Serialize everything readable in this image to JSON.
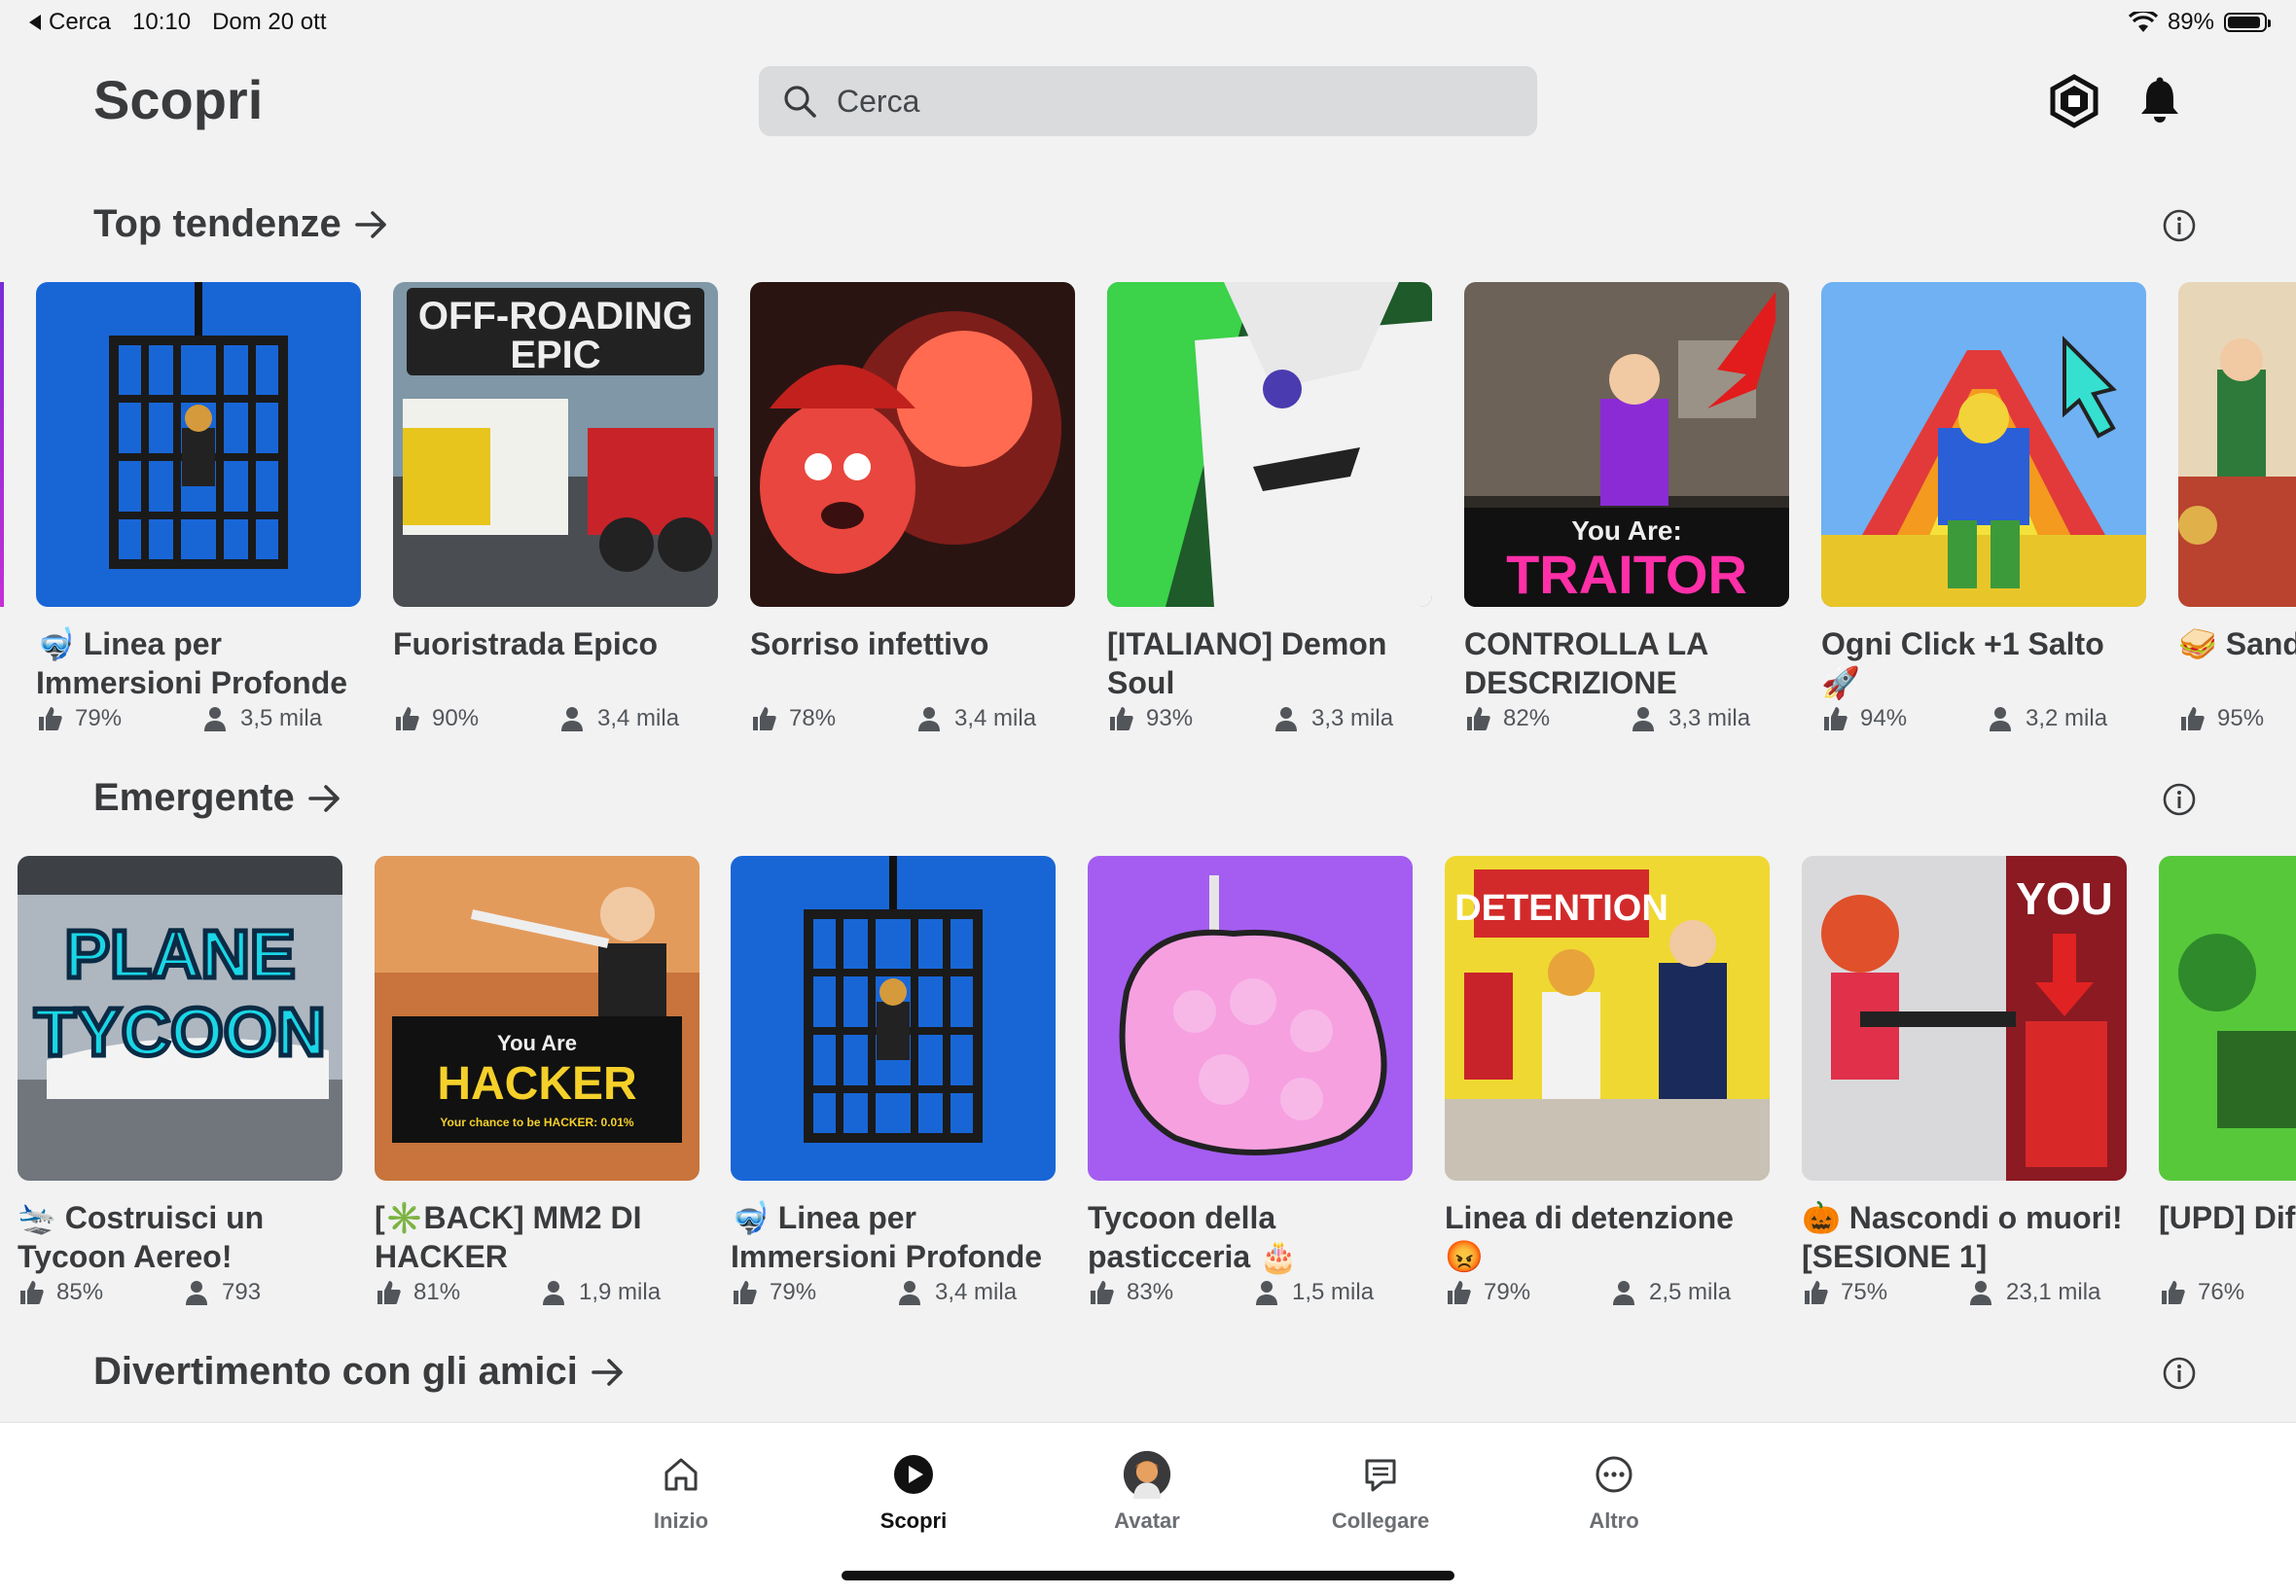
{
  "status_bar": {
    "back_label": "Cerca",
    "time": "10:10",
    "date": "Dom 20 ott",
    "battery": "89%"
  },
  "header": {
    "title": "Scopri",
    "search_placeholder": "Cerca"
  },
  "sections": [
    {
      "title": "Top tendenze",
      "cards": [
        {
          "title": "🤿 Linea per Immersioni Profonde",
          "rating": "79%",
          "players": "3,5 mila"
        },
        {
          "title": "Fuoristrada Epico",
          "rating": "90%",
          "players": "3,4 mila",
          "thumb_text": "OFF-ROADING EPIC"
        },
        {
          "title": "Sorriso infettivo",
          "rating": "78%",
          "players": "3,4 mila"
        },
        {
          "title": "[ITALIANO] Demon Soul",
          "rating": "93%",
          "players": "3,3 mila"
        },
        {
          "title": "CONTROLLA LA DESCRIZIONE",
          "rating": "82%",
          "players": "3,3 mila",
          "thumb_text_small": "You Are:",
          "thumb_text": "TRAITOR"
        },
        {
          "title": "Ogni Click +1 Salto 🚀",
          "rating": "94%",
          "players": "3,2 mila"
        },
        {
          "title": "🥪 Sand Ristoran",
          "rating": "95%",
          "players": ""
        }
      ]
    },
    {
      "title": "Emergente",
      "cards": [
        {
          "title": "🛬 Costruisci un Tycoon Aereo!",
          "rating": "85%",
          "players": "793",
          "thumb_text": "PLANE TYCOON"
        },
        {
          "title": "[✳️BACK] MM2 DI HACKER",
          "rating": "81%",
          "players": "1,9 mila",
          "thumb_text_small": "You Are",
          "thumb_text": "HACKER",
          "thumb_text_tiny": "Your chance to be HACKER: 0.01%"
        },
        {
          "title": "🤿 Linea per Immersioni Profonde",
          "rating": "79%",
          "players": "3,4 mila"
        },
        {
          "title": "Tycoon della pasticceria 🎂",
          "rating": "83%",
          "players": "1,5 mila"
        },
        {
          "title": "Linea di detenzione 😡",
          "rating": "79%",
          "players": "2,5 mila",
          "thumb_text": "DETENTION"
        },
        {
          "title": "🎃 Nascondi o muori! [SESIONE 1]",
          "rating": "75%",
          "players": "23,1 mila",
          "thumb_text": "YOU"
        },
        {
          "title": "[UPD] Dife giardino!",
          "rating": "76%",
          "players": ""
        }
      ]
    },
    {
      "title": "Divertimento con gli amici",
      "cards": []
    }
  ],
  "bottom_nav": [
    {
      "label": "Inizio",
      "icon": "home-icon"
    },
    {
      "label": "Scopri",
      "icon": "play-icon",
      "active": true
    },
    {
      "label": "Avatar",
      "icon": "avatar-icon"
    },
    {
      "label": "Collegare",
      "icon": "chat-icon"
    },
    {
      "label": "Altro",
      "icon": "more-icon"
    }
  ]
}
